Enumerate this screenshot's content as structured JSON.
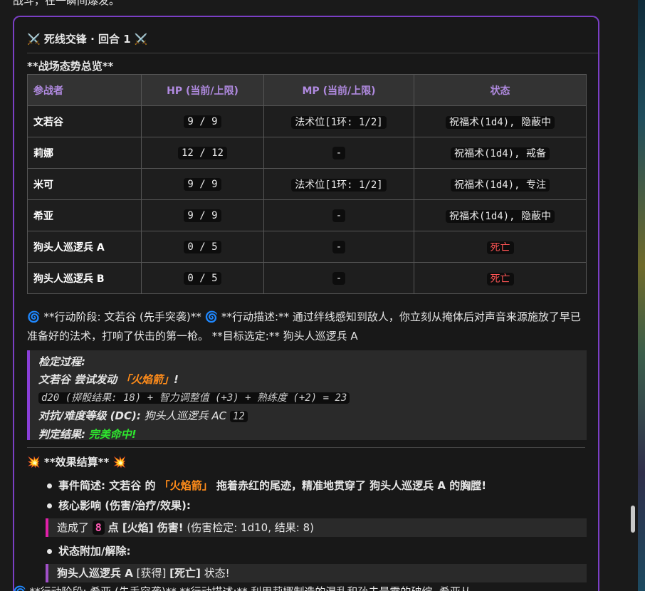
{
  "top_line": "战斗，在一瞬间爆发。",
  "round": {
    "title": "⚔️ 死线交锋 · 回合 1 ⚔️"
  },
  "overview_title": "**战场态势总览**",
  "table": {
    "headers": [
      "参战者",
      "HP (当前/上限)",
      "MP (当前/上限)",
      "状态"
    ],
    "rows": [
      {
        "name": "文若谷",
        "hp": "9 / 9",
        "mp": "法术位[1环: 1/2]",
        "status": "祝福术(1d4), 隐蔽中",
        "dead": false
      },
      {
        "name": "莉娜",
        "hp": "12 / 12",
        "mp": "-",
        "status": "祝福术(1d4), 戒备",
        "dead": false
      },
      {
        "name": "米可",
        "hp": "9 / 9",
        "mp": "法术位[1环: 1/2]",
        "status": "祝福术(1d4), 专注",
        "dead": false
      },
      {
        "name": "希亚",
        "hp": "9 / 9",
        "mp": "-",
        "status": "祝福术(1d4), 隐蔽中",
        "dead": false
      },
      {
        "name": "狗头人巡逻兵 A",
        "hp": "0 / 5",
        "mp": "-",
        "status": "死亡",
        "dead": true
      },
      {
        "name": "狗头人巡逻兵 B",
        "hp": "0 / 5",
        "mp": "-",
        "status": "死亡",
        "dead": true
      }
    ]
  },
  "action": {
    "phase_label": "**行动阶段: 文若谷 (先手突袭)**",
    "desc_label": "**行动描述:**",
    "desc_text": "通过绊线感知到敌人，你立刻从掩体后对声音来源施放了早已准备好的法术，打响了伏击的第一枪。",
    "target_label": "**目标选定:**",
    "target_text": "狗头人巡逻兵 A"
  },
  "check": {
    "title": "检定过程:",
    "actor": "文若谷 尝试发动",
    "spell": "「火焰箭」",
    "excl": "!",
    "roll": "d20 (掷骰结果: 18) + 智力调整值 (+3) + 熟练度 (+2) = 23",
    "dc_label": "对抗/难度等级 (DC):",
    "dc_target": "狗头人巡逻兵 AC",
    "dc_value": "12",
    "result_label": "判定结果:",
    "result_value": "完美命中!"
  },
  "effects": {
    "title": "**效果结算**",
    "summary_label": "事件简述:",
    "summary_actor": "文若谷 的",
    "summary_spell": "「火焰箭」",
    "summary_rest": "拖着赤红的尾迹，精准地贯穿了 狗头人巡逻兵 A 的胸膛!",
    "impact_label": "核心影响 (伤害/治疗/效果):",
    "dmg_pre": "造成了",
    "dmg_value": "8",
    "dmg_post": "点 [火焰] 伤害!",
    "dmg_check": "(伤害检定: 1d10, 结果: 8)",
    "status_label": "状态附加/解除:",
    "status_text_a": "狗头人巡逻兵 A",
    "status_text_b": "[获得]",
    "status_text_c": "[死亡]",
    "status_text_d": "状态!"
  },
  "bottom_line": "**行动阶段: 希亚 (先手突袭)** **行动描述:** 利用莉娜制造的混乱和孙夫最需的破绽, 希亚从",
  "icons": {
    "spiral": "cyclone-icon",
    "boom": "collision-icon",
    "swords": "crossed-swords-icon"
  },
  "colors": {
    "accent": "#7a3fc4",
    "spell": "#ff8c1a",
    "hit": "#2ee62e",
    "dead": "#ff5555"
  }
}
